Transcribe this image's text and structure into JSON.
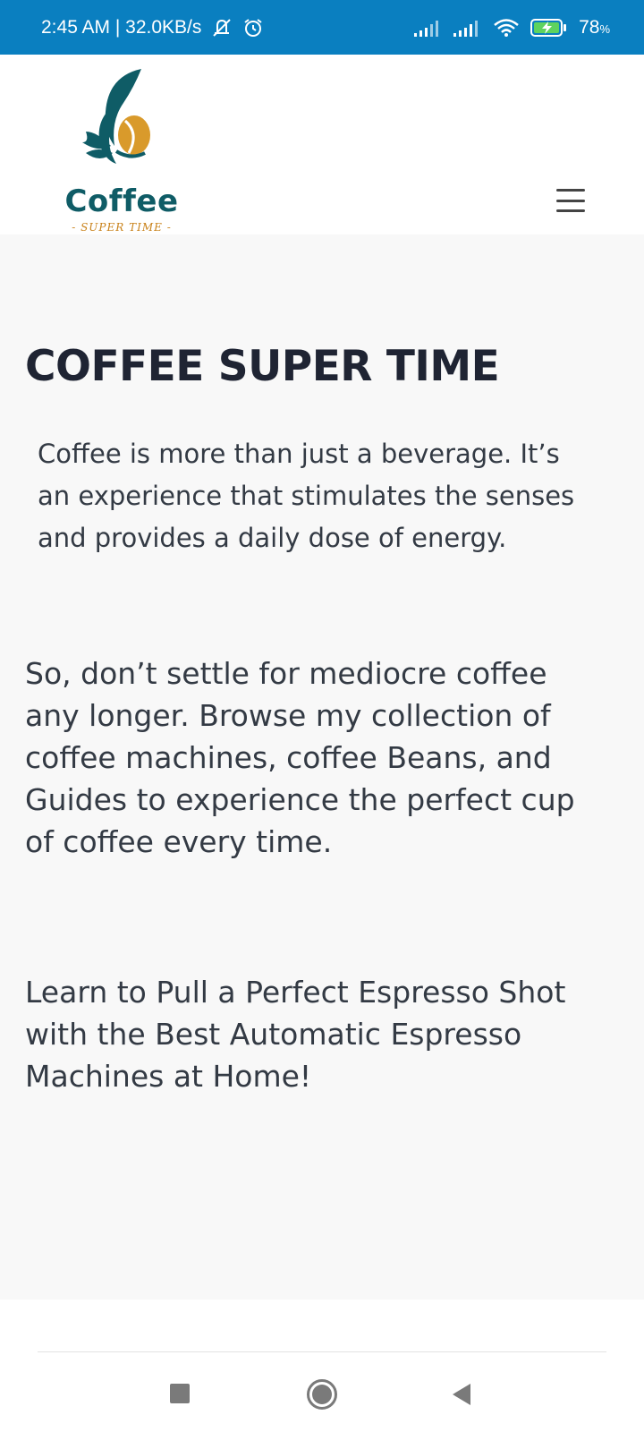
{
  "status_bar": {
    "time_speed": "2:45 AM | 32.0KB/s",
    "battery_percent": "78",
    "battery_unit": "%",
    "icons": [
      "mute-icon",
      "alarm-icon",
      "signal-icon",
      "signal-icon",
      "wifi-icon",
      "battery-charging-icon"
    ]
  },
  "header": {
    "logo_word": "Coffee",
    "logo_tagline": "- SUPER TIME -",
    "menu_icon": "hamburger-menu-icon"
  },
  "main": {
    "title": "COFFEE SUPER TIME",
    "intro": "Coffee is more than just a beverage. It’s an experience that stimulates the senses and provides a daily dose of energy.",
    "paragraph_1": "So, don’t settle for mediocre coffee any longer. Browse my collection of coffee machines, coffee Beans, and Guides to experience the perfect cup of coffee every time.",
    "paragraph_2": "Learn to Pull a Perfect Espresso Shot with the Best Automatic Espresso Machines at Home!"
  },
  "nav_bar": {
    "icons": [
      "recents-icon",
      "home-icon",
      "back-icon"
    ]
  },
  "colors": {
    "status_bar": "#0a7fc0",
    "logo_teal": "#0f5c66",
    "logo_gold": "#c9821a",
    "title_text": "#1f2433",
    "body_text": "#333a44"
  }
}
